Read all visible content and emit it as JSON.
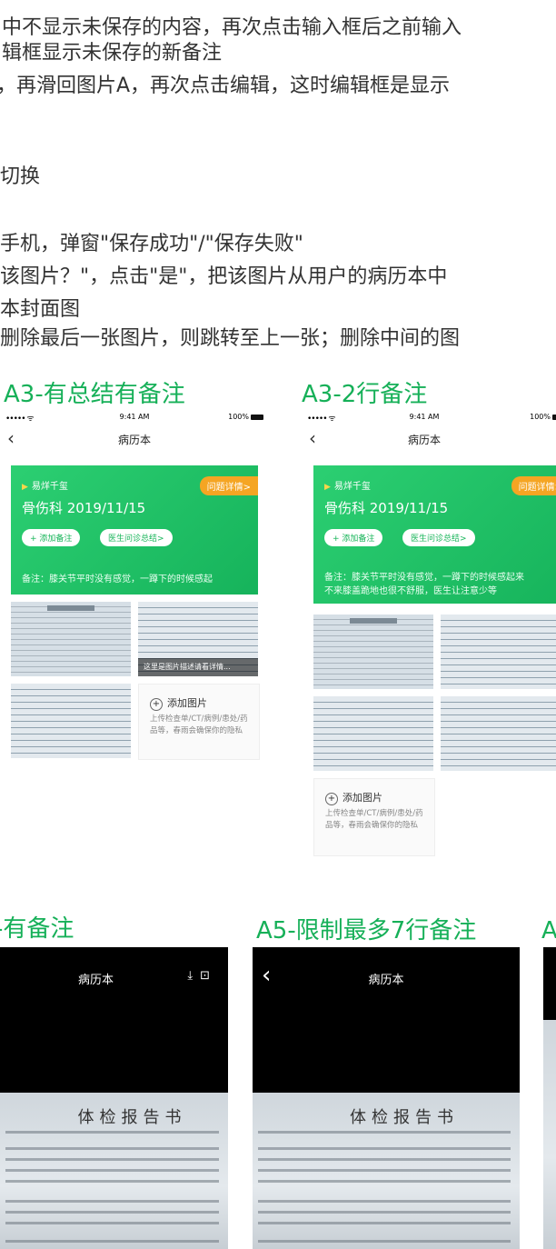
{
  "document": {
    "lines": [
      "中不显示未保存的内容，再次点击输入框后之前输入",
      "辑框显示未保存的新备注",
      "，再滑回图片A，再次点击编辑，这时编辑框是显示",
      "切换",
      "手机，弹窗\"保存成功\"/\"保存失败\"",
      "该图片？\"，点击\"是\"，把该图片从用户的病历本中",
      "本封面图",
      "删除最后一张图片，则跳转至上一张；删除中间的图"
    ]
  },
  "sections": {
    "a3_title": "A3-有总结有备注",
    "a3_2_title": "A3-2行备注",
    "a4_title": "-有备注",
    "a5_title": "A5-限制最多7行备注",
    "a6_title": "A"
  },
  "status_bar": {
    "signal": "••••• ᯤ",
    "time": "9:41 AM",
    "battery": "100%"
  },
  "phone": {
    "back": "‹",
    "title": "病历本",
    "user": "易烊千玺",
    "dept_date": "骨伤科 2019/11/15",
    "question_detail": "问题详情>",
    "add_note": "+ 添加备注",
    "doctor_summary": "医生问诊总结>",
    "note_a3": "备注：膝关节平时没有感觉，一蹲下的时候感起",
    "note_a3_2_line1": "备注：膝关节平时没有感觉，一蹲下的时候感起来",
    "note_a3_2_line2": "不来膝盖跪地也很不舒服，医生让注意少等",
    "thumb_caption": "这里是图片描述请看详情...",
    "add_image": "添加图片",
    "add_image_desc": "上传检查单/CT/病例/患处/药品等，春雨会确保你的隐私"
  },
  "viewer": {
    "title": "病历本",
    "back": "‹",
    "icons": "⤓ 🗑",
    "report_title": "体检报告书"
  },
  "colors": {
    "accent_green": "#18b55a",
    "title_green": "#16b058",
    "question_orange": "#f5a523"
  },
  "icons": [
    "back-chevron-icon",
    "signal-icon",
    "wifi-icon",
    "battery-icon",
    "triangle-bullet-icon",
    "plus-circle-icon",
    "download-icon",
    "trash-icon"
  ]
}
